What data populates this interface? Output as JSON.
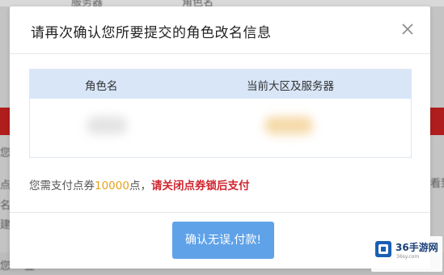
{
  "background": {
    "fragments": [
      "服务器",
      "角色名",
      "您",
      "点",
      "名",
      "建",
      "您",
      "登",
      "看到"
    ]
  },
  "dialog": {
    "title": "请再次确认您所要提交的角色改名信息",
    "close_icon": "close-icon",
    "table": {
      "headers": [
        "角色名",
        "当前大区及服务器"
      ]
    },
    "notice": {
      "prefix": "您需支付点券",
      "points": "10000",
      "suffix": "点，",
      "warning": "请关闭点券锁后支付"
    },
    "confirm_label": "确认无误,付款!"
  },
  "watermark": {
    "name": "36手游网",
    "url": "36sy.com"
  },
  "colors": {
    "table_header_bg": "#d8e6f8",
    "points": "#e6a21a",
    "warning": "#d0262f",
    "button": "#5fa2e8",
    "bg_bar": "#b01d1d"
  }
}
